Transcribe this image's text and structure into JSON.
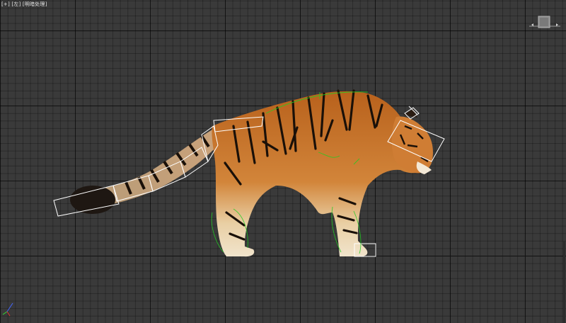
{
  "viewport": {
    "label_parts": [
      "[+]",
      "[左]",
      "[明暗处理]"
    ],
    "grid_color": "#000000",
    "background_color": "#3a3a3a"
  },
  "scene": {
    "bone_color": "#ffffff",
    "skin_envelope_color": "#22cc22",
    "fur_color": "#c4722a",
    "stripe_color": "#1a1008"
  },
  "icons": {
    "viewcube": "viewcube-icon",
    "axis": "axis-tripod-icon"
  }
}
